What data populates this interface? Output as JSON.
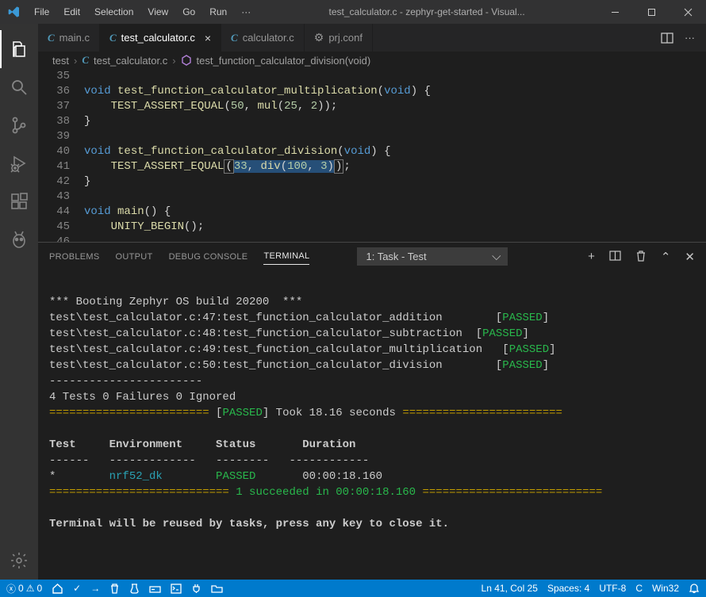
{
  "titlebar": {
    "menu": [
      "File",
      "Edit",
      "Selection",
      "View",
      "Go",
      "Run",
      "···"
    ],
    "title": "test_calculator.c - zephyr-get-started - Visual..."
  },
  "tabs": [
    {
      "icon": "c",
      "label": "main.c",
      "active": false,
      "close": false
    },
    {
      "icon": "c",
      "label": "test_calculator.c",
      "active": true,
      "close": true
    },
    {
      "icon": "c",
      "label": "calculator.c",
      "active": false,
      "close": false
    },
    {
      "icon": "gear",
      "label": "prj.conf",
      "active": false,
      "close": false
    }
  ],
  "breadcrumb": {
    "folder": "test",
    "file": "test_calculator.c",
    "symbol": "test_function_calculator_division(void)"
  },
  "code": [
    {
      "n": 35,
      "t": ""
    },
    {
      "n": 36,
      "t": "void test_function_calculator_multiplication(void) {"
    },
    {
      "n": 37,
      "t": "    TEST_ASSERT_EQUAL(50, mul(25, 2));"
    },
    {
      "n": 38,
      "t": "}"
    },
    {
      "n": 39,
      "t": ""
    },
    {
      "n": 40,
      "t": "void test_function_calculator_division(void) {"
    },
    {
      "n": 41,
      "t": "    TEST_ASSERT_EQUAL(33, div(100, 3));"
    },
    {
      "n": 42,
      "t": "}"
    },
    {
      "n": 43,
      "t": ""
    },
    {
      "n": 44,
      "t": "void main() {"
    },
    {
      "n": 45,
      "t": "    UNITY_BEGIN();"
    },
    {
      "n": 46,
      "t": ""
    }
  ],
  "panel": {
    "tabs": [
      "PROBLEMS",
      "OUTPUT",
      "DEBUG CONSOLE",
      "TERMINAL"
    ],
    "active": "TERMINAL",
    "selector": "1: Task - Test"
  },
  "terminal": {
    "boot": "*** Booting Zephyr OS build 20200  ***",
    "tests": [
      {
        "line": "test\\test_calculator.c:47:test_function_calculator_addition",
        "pad": "     ",
        "status": "PASSED"
      },
      {
        "line": "test\\test_calculator.c:48:test_function_calculator_subtraction",
        "pad": "  ",
        "status": "PASSED"
      },
      {
        "line": "test\\test_calculator.c:49:test_function_calculator_multiplication",
        "pad": "   ",
        "status": "PASSED",
        "wide": true
      },
      {
        "line": "test\\test_calculator.c:50:test_function_calculator_division",
        "pad": "     ",
        "status": "PASSED"
      }
    ],
    "divider": "-----------------------",
    "summary": "4 Tests 0 Failures 0 Ignored",
    "took": "Took 18.16 seconds",
    "table": {
      "headers": [
        "Test",
        "Environment",
        "Status",
        "Duration"
      ],
      "row": {
        "test": "*",
        "env": "nrf52_dk",
        "status": "PASSED",
        "dur": "00:00:18.160"
      },
      "footer": "1 succeeded in 00:00:18.160"
    },
    "reuse": "Terminal will be reused by tasks, press any key to close it."
  },
  "status": {
    "errors": "0",
    "warnings": "0",
    "cursor": "Ln 41, Col 25",
    "spaces": "Spaces: 4",
    "encoding": "UTF-8",
    "lang": "C",
    "os": "Win32"
  }
}
